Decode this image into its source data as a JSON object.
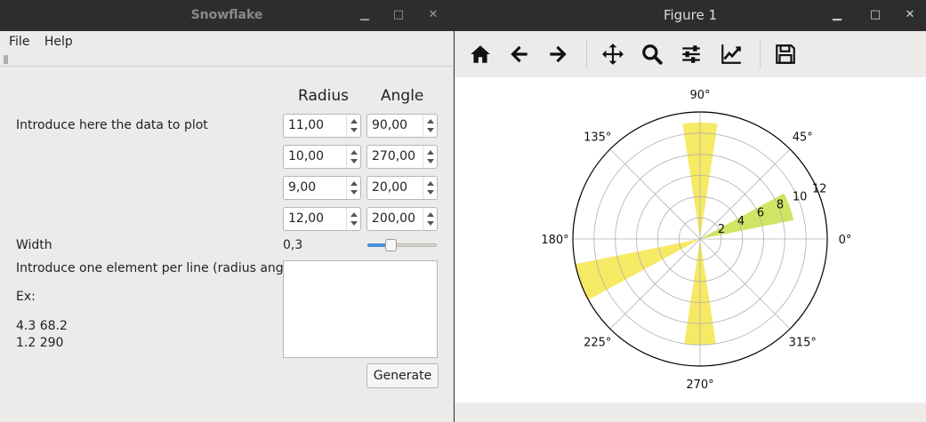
{
  "left_window": {
    "title": "Snowflake",
    "menu": [
      "File",
      "Help"
    ],
    "headers": {
      "radius": "Radius",
      "angle": "Angle"
    },
    "intro_label": "Introduce here the data to plot",
    "rows": [
      {
        "radius": "11,00",
        "angle": "90,00"
      },
      {
        "radius": "10,00",
        "angle": "270,00"
      },
      {
        "radius": "9,00",
        "angle": "20,00"
      },
      {
        "radius": "12,00",
        "angle": "200,00"
      }
    ],
    "width_label": "Width",
    "width_value": "0,3",
    "width_slider_fraction": 0.3,
    "per_line_label": "Introduce one element per line (radius angle)",
    "example_label": "Ex:",
    "example_line1": "4.3 68.2",
    "example_line2": "1.2 290",
    "textarea_value": "",
    "generate_label": "Generate"
  },
  "right_window": {
    "title": "Figure 1",
    "toolbar": [
      "home-icon",
      "back-icon",
      "forward-icon",
      "pan-icon",
      "zoom-icon",
      "configure-subplots-icon",
      "edit-axes-icon",
      "save-icon"
    ]
  },
  "chart_data": {
    "type": "polar-bar",
    "theta_tick_labels": [
      "0°",
      "45°",
      "90°",
      "135°",
      "180°",
      "225°",
      "270°",
      "315°"
    ],
    "theta_ticks_deg": [
      0,
      45,
      90,
      135,
      180,
      225,
      270,
      315
    ],
    "r_tick_labels": [
      "2",
      "4",
      "6",
      "8",
      "10",
      "12"
    ],
    "r_ticks": [
      2,
      4,
      6,
      8,
      10,
      12
    ],
    "rlim": [
      0,
      12
    ],
    "grid": true,
    "bar_width_rad": 0.3,
    "bars": [
      {
        "theta_deg": 90,
        "r": 11,
        "color": "#f5e64a"
      },
      {
        "theta_deg": 270,
        "r": 10,
        "color": "#f5e64a"
      },
      {
        "theta_deg": 20,
        "r": 9,
        "color": "#c8e04a"
      },
      {
        "theta_deg": 200,
        "r": 12,
        "color": "#f5e64a"
      }
    ]
  },
  "colors": {
    "titlebar": "#2d2d2d",
    "window_bg": "#edebe9",
    "slider_accent": "#4a90d9"
  }
}
